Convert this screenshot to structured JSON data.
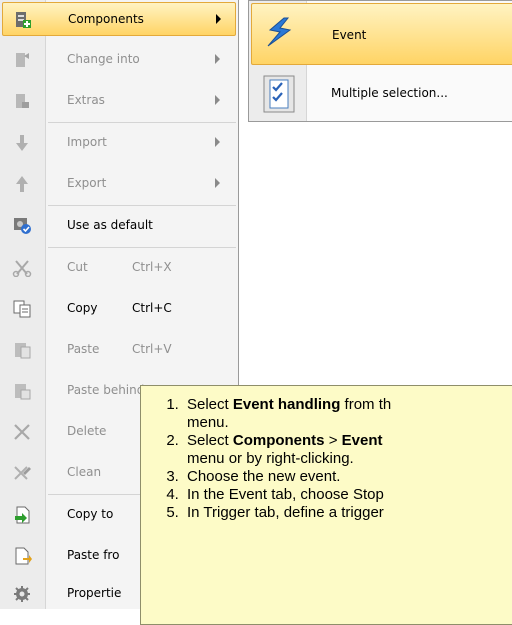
{
  "menu": {
    "items": [
      {
        "label": "Components",
        "icon": "add-component-icon",
        "state": "selected",
        "submenu": true
      },
      {
        "label": "Change into",
        "icon": "change-into-icon",
        "state": "disabled",
        "submenu": true
      },
      {
        "label": "Extras",
        "icon": "extras-icon",
        "state": "disabled",
        "submenu": true
      },
      {
        "label": "Import",
        "icon": "import-arrow-down-icon",
        "state": "disabled",
        "submenu": true
      },
      {
        "label": "Export",
        "icon": "export-arrow-up-icon",
        "state": "disabled",
        "submenu": true
      },
      {
        "label": "Use as default",
        "icon": "use-as-default-icon",
        "state": "enabled"
      },
      {
        "label": "Cut",
        "shortcut": "Ctrl+X",
        "icon": "scissors-icon",
        "state": "disabled"
      },
      {
        "label": "Copy",
        "shortcut": "Ctrl+C",
        "icon": "copy-icon",
        "state": "enabled"
      },
      {
        "label": "Paste",
        "shortcut": "Ctrl+V",
        "icon": "paste-icon",
        "state": "disabled"
      },
      {
        "label": "Paste behind",
        "icon": "paste-behind-icon",
        "state": "disabled"
      },
      {
        "label": "Delete",
        "icon": "delete-x-icon",
        "state": "disabled"
      },
      {
        "label": "Clean",
        "icon": "clean-icon",
        "state": "disabled"
      },
      {
        "label": "Copy to",
        "icon": "copy-to-icon",
        "state": "enabled"
      },
      {
        "label": "Paste fro",
        "icon": "paste-from-icon",
        "state": "enabled"
      },
      {
        "label": "Propertie",
        "icon": "properties-gear-icon",
        "state": "enabled"
      }
    ]
  },
  "submenu": {
    "items": [
      {
        "label": "Event",
        "icon": "event-lightning-icon",
        "state": "selected"
      },
      {
        "label": "Multiple selection...",
        "icon": "multiple-selection-checklist-icon",
        "state": "enabled"
      }
    ]
  },
  "tooltip": {
    "steps": [
      {
        "pre": "Select ",
        "b1": "Event handling",
        "mid": " from th",
        "b2": "",
        "post": "",
        "cont": "menu."
      },
      {
        "pre": "Select ",
        "b1": "Components",
        "mid": " > ",
        "b2": "Event",
        "post": " ",
        "cont": "menu or by right-clicking."
      },
      {
        "pre": "Choose the new event.",
        "b1": "",
        "mid": "",
        "b2": "",
        "post": "",
        "cont": ""
      },
      {
        "pre": "In the Event tab, choose Stop",
        "b1": "",
        "mid": "",
        "b2": "",
        "post": "",
        "cont": ""
      },
      {
        "pre": "In Trigger tab, define a trigger",
        "b1": "",
        "mid": "",
        "b2": "",
        "post": "",
        "cont": ""
      }
    ]
  },
  "colors": {
    "highlight_top": "#fff3c2",
    "highlight_bottom": "#ffd465",
    "highlight_border": "#e3a93a",
    "tooltip_bg": "#fdfbc7",
    "disabled_text": "#8f8f8f"
  }
}
